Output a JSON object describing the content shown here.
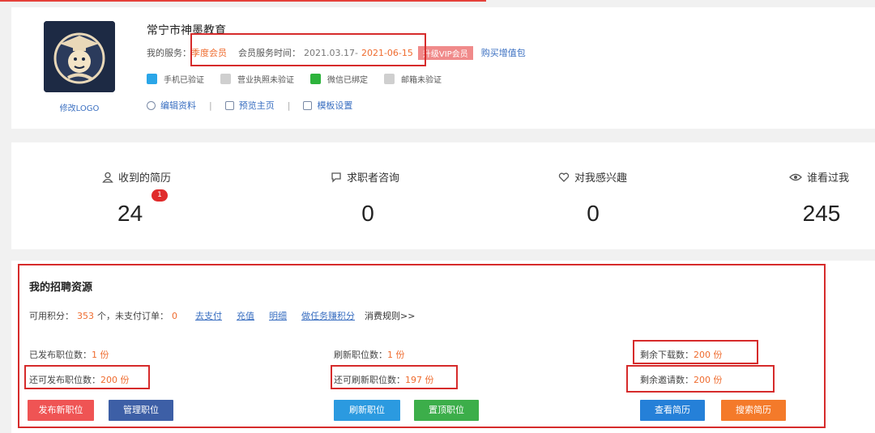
{
  "profile": {
    "company_name": "常宁市神墨教育",
    "logo_link": "修改LOGO",
    "service_label": "我的服务：",
    "service_type": "季度会员",
    "service_time_label": "会员服务时间：",
    "service_start": "2021.03.17-",
    "service_end": "2021-06-15",
    "vip_button": "升级VIP会员",
    "buy_link": "购买增值包",
    "verifications": [
      {
        "icon": "phone-icon",
        "label": "手机已验证"
      },
      {
        "icon": "license-icon",
        "label": "营业执照未验证"
      },
      {
        "icon": "wechat-icon",
        "label": "微信已绑定"
      },
      {
        "icon": "mail-icon",
        "label": "邮箱未验证"
      }
    ],
    "links": [
      {
        "icon": "user-icon",
        "label": "编辑资料"
      },
      {
        "icon": "preview-icon",
        "label": "预览主页"
      },
      {
        "icon": "template-icon",
        "label": "模板设置"
      }
    ]
  },
  "stats": [
    {
      "icon": "user-icon",
      "label": "收到的简历",
      "value": "24",
      "badge": "1"
    },
    {
      "icon": "chat-icon",
      "label": "求职者咨询",
      "value": "0"
    },
    {
      "icon": "heart-icon",
      "label": "对我感兴趣",
      "value": "0"
    },
    {
      "icon": "eye-icon",
      "label": "谁看过我",
      "value": "245"
    }
  ],
  "resources": {
    "title": "我的招聘资源",
    "points_label": "可用积分：",
    "points_value": "353",
    "points_unit": "个，未支付订单：",
    "unpaid_value": "0",
    "go_pay": "去支付",
    "recharge": "充值",
    "details": "明细",
    "earn_points": "做任务赚积分",
    "consume_rules": "消费规则>>",
    "published_label": "已发布职位数：",
    "published_value": "1 份",
    "can_publish_label": "还可发布职位数：",
    "can_publish_value": "200 份",
    "refreshed_label": "刷新职位数：",
    "refreshed_value": "1 份",
    "can_refresh_label": "还可刷新职位数：",
    "can_refresh_value": "197 份",
    "downloads_label": "剩余下载数：",
    "downloads_value": "200 份",
    "invites_label": "剩余邀请数：",
    "invites_value": "200 份",
    "buttons": {
      "publish": "发布新职位",
      "manage": "管理职位",
      "refresh": "刷新职位",
      "top": "置顶职位",
      "view_resume": "查看简历",
      "search_resume": "搜索简历"
    }
  },
  "colors": {
    "accent": "#ef6c2f",
    "highlight_box": "#d62b2b",
    "link": "#3a6fc1"
  }
}
